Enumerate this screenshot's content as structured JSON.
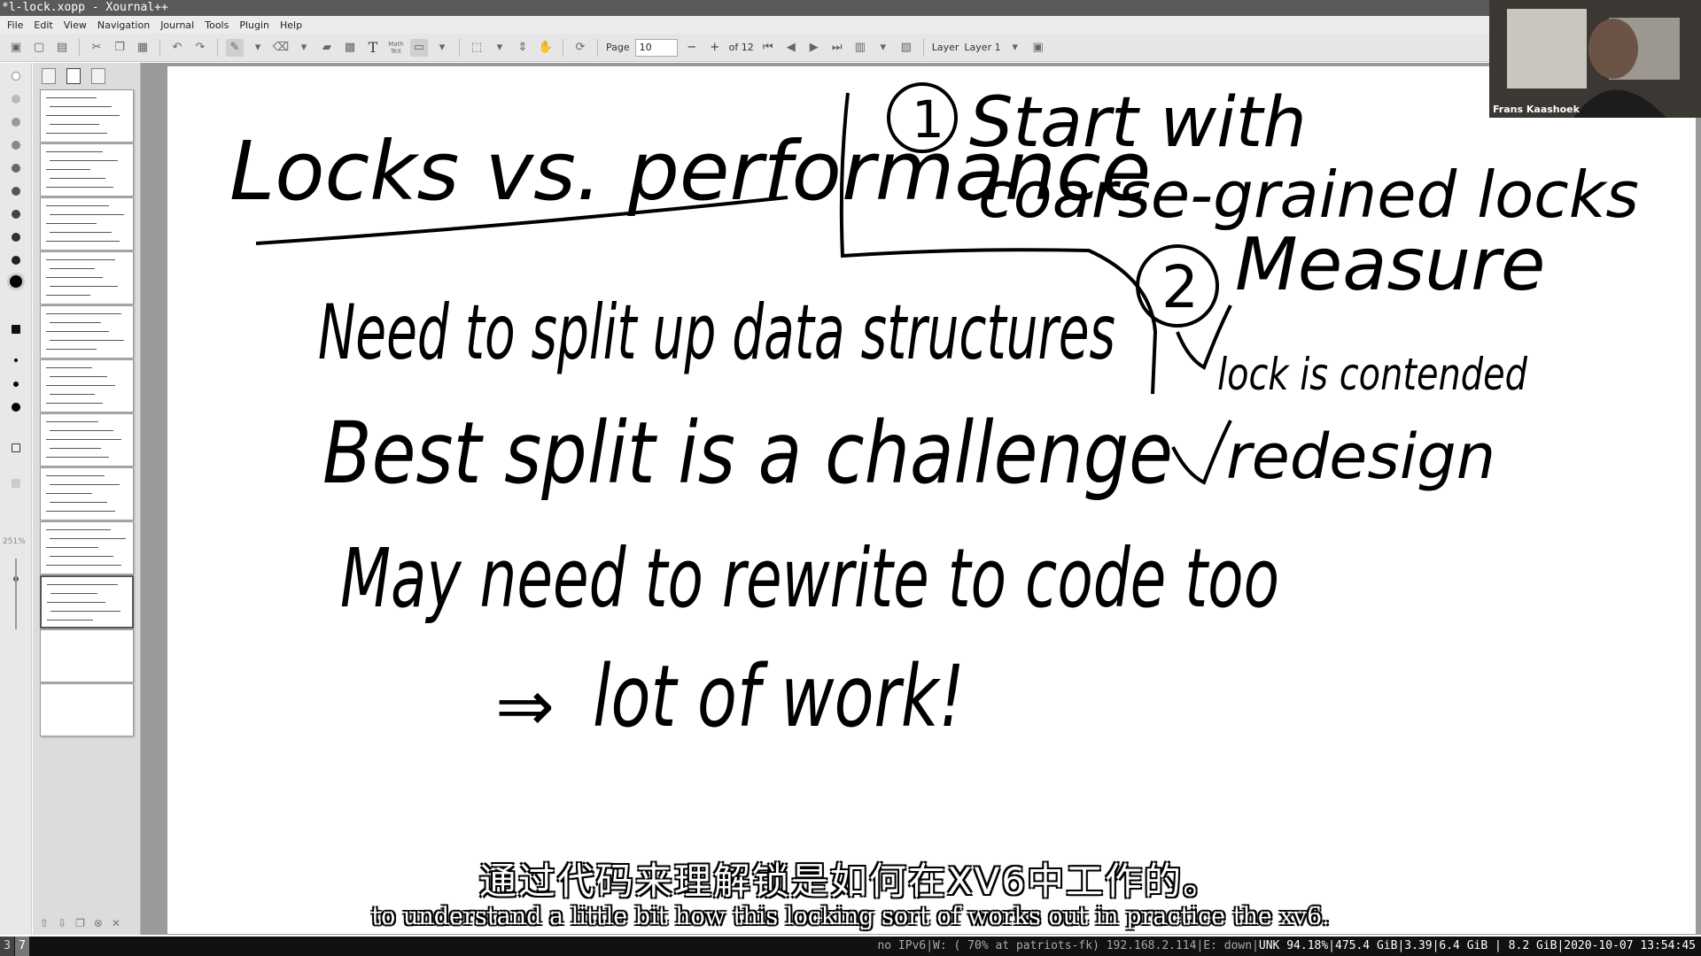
{
  "window": {
    "title": "*l-lock.xopp - Xournal++"
  },
  "menu": [
    "File",
    "Edit",
    "View",
    "Navigation",
    "Journal",
    "Tools",
    "Plugin",
    "Help"
  ],
  "toolbar": {
    "page_label": "Page",
    "page_value": "10",
    "page_of": "of 12",
    "layer_label": "Layer",
    "layer_value": "Layer 1",
    "math_tex_label": "Math TeX"
  },
  "sidebar": {
    "zoom_text": "251%",
    "page_count": 12,
    "selected_page": 10
  },
  "page": {
    "title": "Locks vs. performance",
    "lines": [
      "Need to split up data structures",
      "Best split is a challenge",
      "May need to rewrite to code too",
      "lot of work!"
    ],
    "arrow": "⇒",
    "right_notes": {
      "num1": "1",
      "item1_line1": "Start with",
      "item1_line2": "coarse-grained locks",
      "num2": "2",
      "item2": "Measure",
      "check1": "lock is contended",
      "check2": "redesign"
    }
  },
  "webcam": {
    "name": "Frans Kaashoek"
  },
  "subtitles": {
    "zh": "通过代码来理解锁是如何在XV6中工作的。",
    "en": "to understand a little bit how this locking sort of works out in practice the xv6."
  },
  "statusbar": {
    "workspace_1": "3",
    "workspace_2": "7",
    "network": "no IPv6|W: ( 70% at patriots-fk) 192.168.2.114|E: down|",
    "system": "UNK 94.18%|475.4 GiB|3.39|6.4 GiB | 8.2 GiB|2020-10-07 13:54:45"
  },
  "colors": {
    "ink": "#000000",
    "title_bar": "#5a5a5a",
    "toolbar": "#e6e6e6",
    "canvas_bg": "#9a9a9a"
  }
}
